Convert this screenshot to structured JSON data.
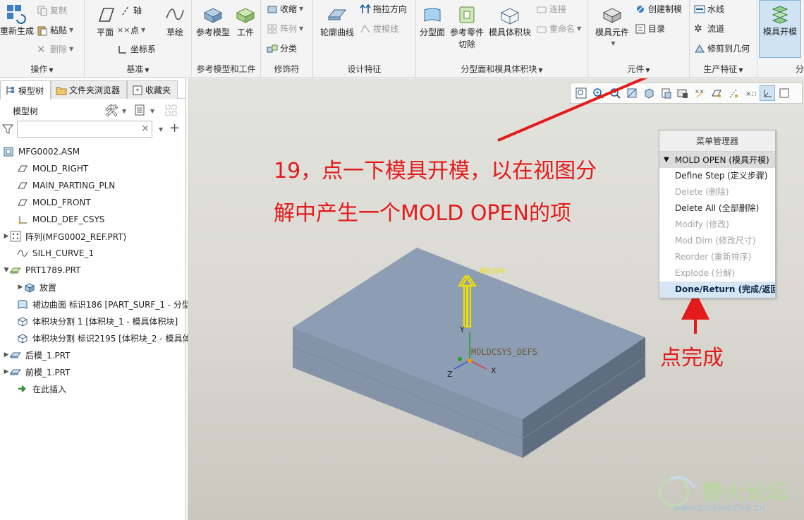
{
  "ribbon": {
    "groups": [
      {
        "label": "操作"
      },
      {
        "label": "基准"
      },
      {
        "label": "参考模型和工件"
      },
      {
        "label": "修饰符"
      },
      {
        "label": "设计特征"
      },
      {
        "label": "分型面和模具体积块"
      },
      {
        "label": "元件"
      },
      {
        "label": "生产特征"
      },
      {
        "label": "分"
      }
    ],
    "operate": {
      "regen": "重新生成",
      "copy": "复制",
      "paste": "粘贴",
      "delete": "删除"
    },
    "datum": {
      "plane": "平面",
      "axis": "轴",
      "point": "点",
      "csys": "坐标系",
      "sketch": "草绘"
    },
    "ref": {
      "ref_model": "参考模型",
      "workpiece": "工件"
    },
    "modifier": {
      "shrink": "收缩",
      "pattern": "阵列",
      "classify": "分类"
    },
    "design": {
      "silhouette": "轮廓曲线",
      "drag_dir": "拖拉方向",
      "draft_line": "拔模线"
    },
    "parting": {
      "parting_surface": "分型面",
      "ref_part_cut": "参考零件切除",
      "mold_volume": "模具体积块",
      "connect": "连接",
      "rename": "重命名"
    },
    "component": {
      "mold_component": "模具元件",
      "create_casting": "创建制模",
      "catalog": "目录"
    },
    "production": {
      "waterline": "水线",
      "runner": "流道",
      "ejector": "修剪到几何"
    },
    "mold_open": {
      "label": "模具开模"
    }
  },
  "sidepanel": {
    "tabs": [
      {
        "label": "模型树"
      },
      {
        "label": "文件夹浏览器"
      },
      {
        "label": "收藏夹"
      }
    ],
    "tree_title": "模型树",
    "filter_placeholder": "",
    "clear": "×",
    "add": "+",
    "tree": [
      {
        "label": "MFG0002.ASM"
      },
      {
        "label": "MOLD_RIGHT"
      },
      {
        "label": "MAIN_PARTING_PLN"
      },
      {
        "label": "MOLD_FRONT"
      },
      {
        "label": "MOLD_DEF_CSYS"
      },
      {
        "label": "阵列(MFG0002_REF.PRT)"
      },
      {
        "label": "SILH_CURVE_1"
      },
      {
        "label": "PRT1789.PRT"
      },
      {
        "label": "放置"
      },
      {
        "label": "裙边曲面 标识186 [PART_SURF_1 - 分型"
      },
      {
        "label": "体积块分割 1 [体积块_1 - 模具体积块]"
      },
      {
        "label": "体积块分割 标识2195 [体积块_2 - 模具体"
      },
      {
        "label": "后模_1.PRT"
      },
      {
        "label": "前模_1.PRT"
      },
      {
        "label": "在此插入"
      }
    ]
  },
  "viewport": {
    "drag_direction_label": "拖拉方向",
    "csys_label": "MOLDCSYS_DEFS",
    "axis_y": "Y",
    "axis_x": "X",
    "axis_z": "Z"
  },
  "menu_manager": {
    "title": "菜单管理器",
    "header": "MOLD OPEN (模具开模)",
    "items": [
      {
        "label": "Define Step (定义步骤)",
        "state": "enabled"
      },
      {
        "label": "Delete (删除)",
        "state": "disabled"
      },
      {
        "label": "Delete All (全部删除)",
        "state": "enabled"
      },
      {
        "label": "Modify (修改)",
        "state": "disabled"
      },
      {
        "label": "Mod Dim (修改尺寸)",
        "state": "disabled"
      },
      {
        "label": "Reorder (重新排序)",
        "state": "disabled"
      },
      {
        "label": "Explode (分解)",
        "state": "disabled"
      },
      {
        "label": "Done/Return (完成/返回)",
        "state": "highlighted"
      }
    ]
  },
  "annotations": {
    "line1": "19，点一下模具开模，以在视图分",
    "line2": "解中产生一个MOLD OPEN的项",
    "done_hint": "点完成",
    "color": "#e31b1b"
  },
  "watermark": {
    "name": "野火论坛",
    "url": "www.proewildfire.cn"
  }
}
